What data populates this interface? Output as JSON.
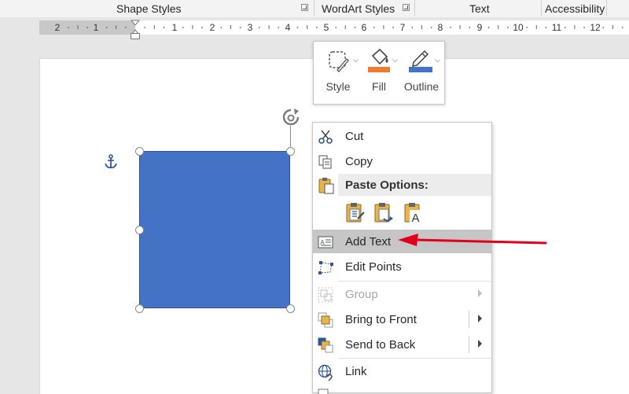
{
  "ribbon": {
    "groups": [
      "Shape Styles",
      "WordArt Styles",
      "Text",
      "Accessibility"
    ]
  },
  "ruler": {
    "labels": [
      "2",
      "1",
      "1",
      "2",
      "3",
      "4",
      "5",
      "6",
      "7",
      "8",
      "9",
      "10",
      "11",
      "12"
    ]
  },
  "mini_toolbar": {
    "style_label": "Style",
    "fill_label": "Fill",
    "outline_label": "Outline",
    "fill_color": "#ed7d31",
    "outline_color": "#4472c4"
  },
  "shape": {
    "fill_color": "#4472c4"
  },
  "context_menu": {
    "cut": "Cut",
    "copy": "Copy",
    "paste_options": "Paste Options:",
    "add_text": "Add Text",
    "edit_points": "Edit Points",
    "group": "Group",
    "bring_to_front": "Bring to Front",
    "send_to_back": "Send to Back",
    "link": "Link"
  },
  "annotation": {
    "arrow_color": "#e3001b"
  }
}
